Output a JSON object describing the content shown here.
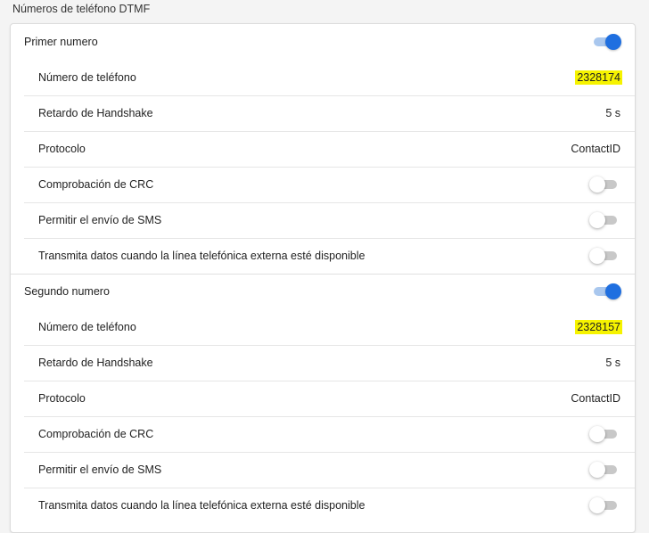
{
  "title": "Números de teléfono DTMF",
  "colors": {
    "accent": "#1f6fe0",
    "highlight": "#f6f300"
  },
  "groups": [
    {
      "name": "Primer numero",
      "enabled": true,
      "phone_label": "Número de teléfono",
      "phone_value": "2328174",
      "handshake_label": "Retardo de Handshake",
      "handshake_value": "5 s",
      "protocol_label": "Protocolo",
      "protocol_value": "ContactID",
      "crc_label": "Comprobación de CRC",
      "crc_enabled": false,
      "sms_label": "Permitir el envío de SMS",
      "sms_enabled": false,
      "external_label": "Transmita datos cuando la línea telefónica externa esté disponible",
      "external_enabled": false
    },
    {
      "name": "Segundo numero",
      "enabled": true,
      "phone_label": "Número de teléfono",
      "phone_value": "2328157",
      "handshake_label": "Retardo de Handshake",
      "handshake_value": "5 s",
      "protocol_label": "Protocolo",
      "protocol_value": "ContactID",
      "crc_label": "Comprobación de CRC",
      "crc_enabled": false,
      "sms_label": "Permitir el envío de SMS",
      "sms_enabled": false,
      "external_label": "Transmita datos cuando la línea telefónica externa esté disponible",
      "external_enabled": false
    }
  ]
}
